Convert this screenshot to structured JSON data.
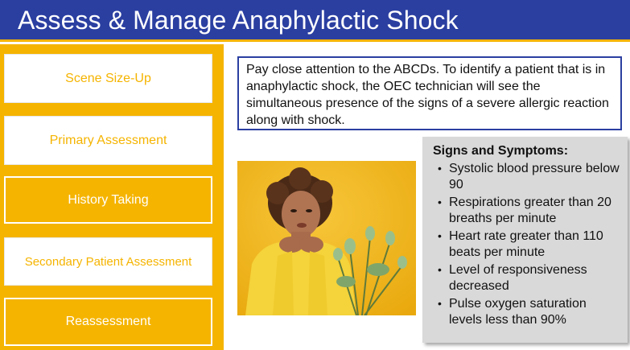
{
  "header": {
    "title": "Assess & Manage Anaphylactic Shock"
  },
  "nav": {
    "items": [
      {
        "label": "Scene Size-Up",
        "state": "inactive"
      },
      {
        "label": "Primary Assessment",
        "state": "inactive"
      },
      {
        "label": "History Taking",
        "state": "active"
      },
      {
        "label": "Secondary Patient Assessment",
        "state": "inactive"
      },
      {
        "label": "Reassessment",
        "state": "active"
      }
    ]
  },
  "callout": {
    "text": "Pay close attention to the ABCDs. To identify a patient that is in anaphylactic shock, the OEC technician will see the simultaneous presence of the signs of a severe allergic reaction along with shock."
  },
  "symptoms": {
    "heading": "Signs and Symptoms:",
    "items": [
      "Systolic blood pressure below 90",
      "Respirations greater than 20 breaths per minute",
      "Heart rate greater than 110 beats per minute",
      "Level of responsiveness decreased",
      "Pulse oxygen saturation levels less than 90%"
    ]
  },
  "colors": {
    "title_bar": "#2b3fa1",
    "accent_yellow": "#f5b400",
    "panel_gray": "#d9d9d9"
  }
}
